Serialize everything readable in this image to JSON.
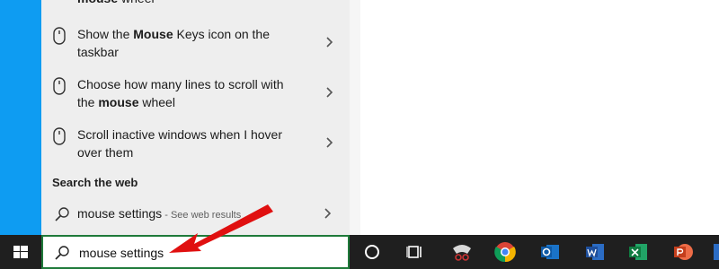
{
  "results": [
    {
      "pre": "",
      "bold": "mouse",
      "post": " wheel",
      "line2": ""
    },
    {
      "pre": "Show the ",
      "bold": "Mouse",
      "post": " Keys icon on the",
      "line2": "taskbar"
    },
    {
      "pre": "Choose how many lines to scroll with",
      "bold": "",
      "post": "",
      "line2pre": "the ",
      "line2bold": "mouse",
      "line2post": " wheel"
    },
    {
      "pre": "Scroll inactive windows when I hover",
      "bold": "",
      "post": "",
      "line2": "over them"
    }
  ],
  "web_section": {
    "title": "Search the web",
    "query": "mouse settings",
    "hint": " - See web results"
  },
  "taskbar": {
    "search_value": "mouse settings",
    "apps": [
      "cortana-icon",
      "task-view-icon",
      "snip-icon",
      "chrome-icon",
      "outlook-icon",
      "word-icon",
      "excel-icon",
      "powerpoint-icon"
    ]
  },
  "colors": {
    "accent": "#0e9cf2",
    "panel": "#eeeeee",
    "taskbar": "#1f1f1f",
    "arrow": "#e01010"
  }
}
